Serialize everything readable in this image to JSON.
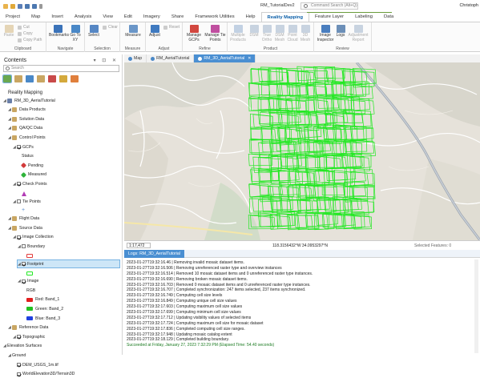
{
  "titlebar": {
    "app_title": "RM_TutorialDev2",
    "search_placeholder": "Command Search (Alt+Q)",
    "user": "Christoph"
  },
  "ribbon_tabs": [
    "Project",
    "Map",
    "Insert",
    "Analysis",
    "View",
    "Edit",
    "Imagery",
    "Share",
    "Framework Utilities",
    "Help",
    "Reality Mapping",
    "Feature Layer",
    "Labeling",
    "Data"
  ],
  "ribbon": {
    "groups": [
      {
        "label": "Clipboard"
      },
      {
        "label": "Navigate"
      },
      {
        "label": "Selection"
      },
      {
        "label": "Measure"
      },
      {
        "label": "Adjust"
      },
      {
        "label": "Refine"
      },
      {
        "label": "Product"
      },
      {
        "label": "Review"
      }
    ],
    "clipboard": {
      "paste": "Paste",
      "cut": "Cut",
      "copy": "Copy",
      "copy_path": "Copy Path"
    },
    "navigate": {
      "bookmarks": "Bookmarks",
      "go_to_xy": "Go To XY"
    },
    "selection": {
      "select": "Select",
      "clear": "Clear"
    },
    "measure": {
      "measure": "Measure"
    },
    "adjust": {
      "adjust": "Adjust",
      "reset": "Reset"
    },
    "refine": {
      "manage_gcps": "Manage GCPs",
      "manage_tie_points": "Manage Tie Points"
    },
    "product": {
      "multiple_products": "Multiple Products",
      "dsm": "DSM",
      "true_ortho": "True Ortho",
      "dsm_mesh": "DSM Mesh",
      "point_cloud": "Point Cloud",
      "mesh_3d": "3D Mesh"
    },
    "review": {
      "image_inspector": "Image Inspector",
      "logs": "Logs",
      "adjustment_report": "Adjustment Report"
    }
  },
  "contents": {
    "title": "Contents",
    "search_placeholder": "Search",
    "heading": "Reality Mapping",
    "tree": [
      {
        "label": "RM_3D_AerialTutorial",
        "level": 0,
        "icon": "workspace"
      },
      {
        "label": "Data Products",
        "level": 1,
        "icon": "folder"
      },
      {
        "label": "Solution Data",
        "level": 1,
        "icon": "folder"
      },
      {
        "label": "QA/QC Data",
        "level": 1,
        "icon": "folder"
      },
      {
        "label": "Control Points",
        "level": 1,
        "icon": "folder"
      },
      {
        "label": "GCPs",
        "level": 2,
        "icon": "checkbox"
      },
      {
        "label": "Status",
        "level": 3,
        "icon": "none"
      },
      {
        "label": "Pending",
        "level": 3,
        "icon": "pending"
      },
      {
        "label": "Measured",
        "level": 3,
        "icon": "measured"
      },
      {
        "label": "Check Points",
        "level": 2,
        "icon": "checkbox"
      },
      {
        "label": "",
        "level": 3,
        "icon": "checkpt"
      },
      {
        "label": "Tie Points",
        "level": 2,
        "icon": "checkbox-off"
      },
      {
        "label": "",
        "level": 3,
        "icon": "plus"
      },
      {
        "label": "Flight Data",
        "level": 1,
        "icon": "folder"
      },
      {
        "label": "Source Data",
        "level": 1,
        "icon": "folder"
      },
      {
        "label": "Image Collection",
        "level": 2,
        "icon": "checkbox"
      },
      {
        "label": "Boundary",
        "level": 3,
        "icon": "checkbox-off"
      },
      {
        "label": "",
        "level": 4,
        "icon": "red-square"
      },
      {
        "label": "Footprint",
        "level": 3,
        "icon": "checkbox",
        "selected": true
      },
      {
        "label": "",
        "level": 4,
        "icon": "green-square"
      },
      {
        "label": "Image",
        "level": 3,
        "icon": "checkbox"
      },
      {
        "label": "RGB",
        "level": 4,
        "icon": "none"
      },
      {
        "label": "Red:  Band_1",
        "level": 4,
        "icon": "red"
      },
      {
        "label": "Green: Band_2",
        "level": 4,
        "icon": "green"
      },
      {
        "label": "Blue:  Band_3",
        "level": 4,
        "icon": "blue"
      },
      {
        "label": "Reference Data",
        "level": 1,
        "icon": "folder"
      },
      {
        "label": "Topographic",
        "level": 2,
        "icon": "checkbox"
      },
      {
        "label": "Elevation Surfaces",
        "level": 0,
        "icon": "none"
      },
      {
        "label": "Ground",
        "level": 1,
        "icon": "none"
      },
      {
        "label": "DEM_USGS_1m.tif",
        "level": 2,
        "icon": "checkbox"
      },
      {
        "label": "WorldElevation3D/Terrain3D",
        "level": 2,
        "icon": "checkbox"
      }
    ]
  },
  "doc_tabs": [
    {
      "label": "Map",
      "active": false
    },
    {
      "label": "RM_AerialTutorial",
      "active": false
    },
    {
      "label": "RM_3D_AerialTutorial",
      "active": true
    }
  ],
  "map_status": {
    "scale": "1:17,472",
    "coords": "118.3156432°W 34.0953297°N",
    "selected": "Selected Features: 0"
  },
  "logs": {
    "tab": "Logs: RM_3D_AerialTutorial",
    "lines": [
      {
        "text": "2023-01-27T19:32:16.46 | Removing invalid mosaic dataset items.",
        "ok": false
      },
      {
        "text": "2023-01-27T19:32:16.506 | Removing unreferenced raster type and overview instances",
        "ok": false
      },
      {
        "text": "2023-01-27T19:32:16.514 | Removed 10 mosaic dataset items and 0 unreferenced raster type instances.",
        "ok": false
      },
      {
        "text": "2023-01-27T19:32:16.690 | Removing broken mosaic dataset items.",
        "ok": false
      },
      {
        "text": "2023-01-27T19:32:16.703 | Removed 0 mosaic dataset items and 0 unreferenced raster type instances.",
        "ok": false
      },
      {
        "text": "2023-01-27T19:32:16.707 | Completed synchronization: 247 items selected, 237 items synchronized.",
        "ok": false
      },
      {
        "text": "2023-01-27T19:32:16.749 | Computing cell size levels",
        "ok": false
      },
      {
        "text": "2023-01-27T19:32:16.849 | Computing unique cell size values",
        "ok": false
      },
      {
        "text": "2023-01-27T19:32:17.603 | Computing maximum cell size values",
        "ok": false
      },
      {
        "text": "2023-01-27T19:32:17.699 | Computing minimum cell size values",
        "ok": false
      },
      {
        "text": "2023-01-27T19:32:17.712 | Updating visibility values of selected items",
        "ok": false
      },
      {
        "text": "2023-01-27T19:32:17.724 | Computing maximum cell size for mosaic dataset",
        "ok": false
      },
      {
        "text": "2023-01-27T19:32:17.836 | Completed computing cell size ranges.",
        "ok": false
      },
      {
        "text": "2023-01-27T19:32:17.948 | Updating mosaic catalog extent",
        "ok": false
      },
      {
        "text": "2023-01-27T19:32:18.129 | Completed building boundary.",
        "ok": false
      },
      {
        "text": "Succeeded at Friday, January 27, 2023 7:32:29 PM (Elapsed Time: 54.40 seconds)",
        "ok": true
      }
    ]
  },
  "colors": {
    "accent": "#0a5ea8",
    "footprint": "#22e822",
    "tab_active": "#4a8fd2"
  }
}
